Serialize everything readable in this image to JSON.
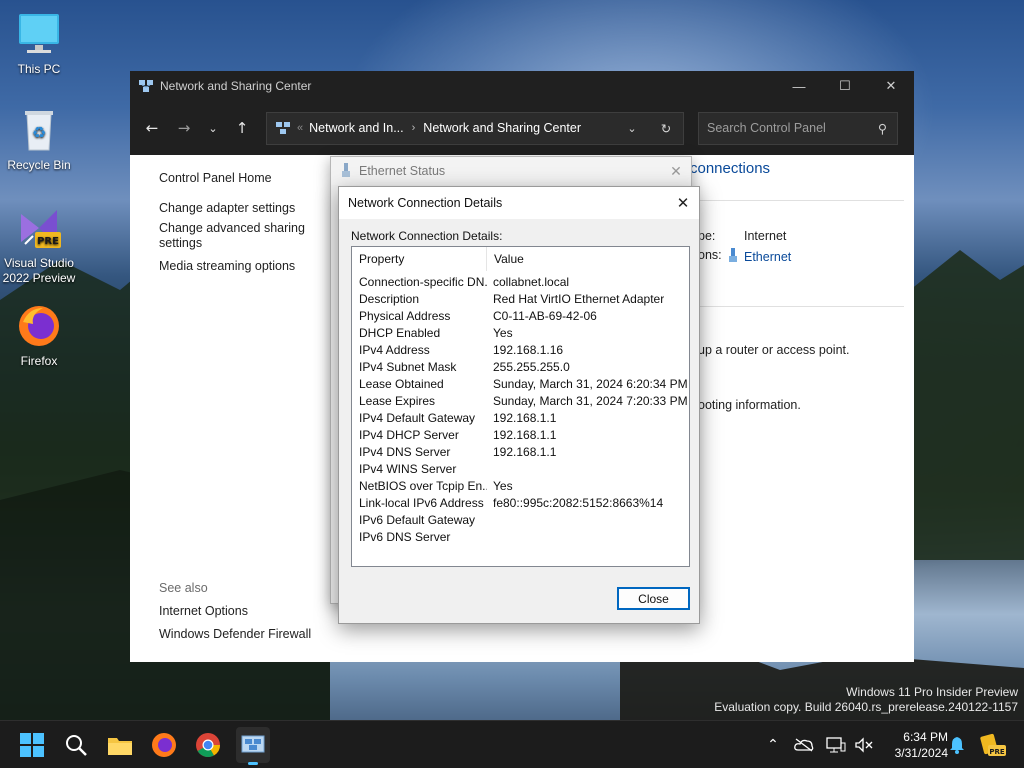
{
  "desktop": {
    "icons": [
      {
        "label": "This PC"
      },
      {
        "label": "Recycle Bin"
      },
      {
        "label": "Visual Studio 2022 Preview"
      },
      {
        "label": "Firefox"
      }
    ]
  },
  "main_window": {
    "title": "Network and Sharing Center",
    "address": {
      "crumb1": "Network and In...",
      "crumb2": "Network and Sharing Center"
    },
    "search_placeholder": "Search Control Panel",
    "left_nav": [
      "Control Panel Home",
      "Change adapter settings",
      "Change advanced sharing settings",
      "Media streaming options"
    ],
    "see_also": {
      "title": "See also",
      "links": [
        "Internet Options",
        "Windows Defender Firewall"
      ]
    },
    "right_pane": {
      "heading_fragment": "connections",
      "access_type_label": "pe:",
      "access_type_value": "Internet",
      "connections_label": "ons:",
      "connections_value": "Ethernet",
      "text1": "up a router or access point.",
      "text2": "ooting information."
    }
  },
  "ethernet_status_dialog": {
    "title": "Ethernet Status"
  },
  "details_dialog": {
    "title": "Network Connection Details",
    "list_label": "Network Connection Details:",
    "columns": [
      "Property",
      "Value"
    ],
    "rows": [
      [
        "Connection-specific DN...",
        "collabnet.local"
      ],
      [
        "Description",
        "Red Hat VirtIO Ethernet Adapter"
      ],
      [
        "Physical Address",
        "C0-11-AB-69-42-06"
      ],
      [
        "DHCP Enabled",
        "Yes"
      ],
      [
        "IPv4 Address",
        "192.168.1.16"
      ],
      [
        "IPv4 Subnet Mask",
        "255.255.255.0"
      ],
      [
        "Lease Obtained",
        "Sunday, March 31, 2024 6:20:34 PM"
      ],
      [
        "Lease Expires",
        "Sunday, March 31, 2024 7:20:33 PM"
      ],
      [
        "IPv4 Default Gateway",
        "192.168.1.1"
      ],
      [
        "IPv4 DHCP Server",
        "192.168.1.1"
      ],
      [
        "IPv4 DNS Server",
        "192.168.1.1"
      ],
      [
        "IPv4 WINS Server",
        ""
      ],
      [
        "NetBIOS over Tcpip En...",
        "Yes"
      ],
      [
        "Link-local IPv6 Address",
        "fe80::995c:2082:5152:8663%14"
      ],
      [
        "IPv6 Default Gateway",
        ""
      ],
      [
        "IPv6 DNS Server",
        ""
      ]
    ],
    "close_label": "Close"
  },
  "watermark": {
    "line1": "Windows 11 Pro Insider Preview",
    "line2": "Evaluation copy. Build 26040.rs_prerelease.240122-1157"
  },
  "taskbar": {
    "time": "6:34 PM",
    "date": "3/31/2024"
  },
  "colors": {
    "link_blue": "#0a4a9a",
    "accent": "#0067c0",
    "titlebar_dark": "#202020"
  }
}
